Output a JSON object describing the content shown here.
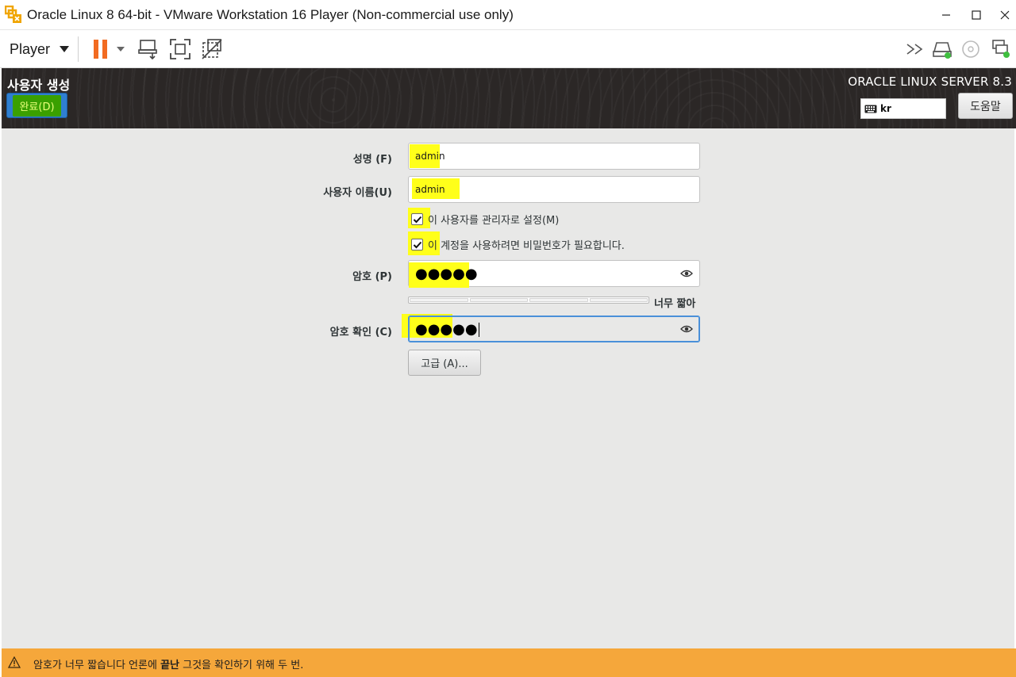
{
  "window": {
    "title": "Oracle Linux 8 64-bit - VMware Workstation 16 Player (Non-commercial use only)",
    "minimize": "—",
    "maximize": "☐",
    "close": "✕"
  },
  "toolbar": {
    "player_label": "Player",
    "icons": [
      "pause-icon",
      "dropdown-caret-icon",
      "send-ctrl-alt-del-icon",
      "full-screen-icon",
      "unity-icon",
      "forward-arrows-icon",
      "hard-disk-icon",
      "cd-rom-icon",
      "network-adapter-icon"
    ],
    "accent_color": "#f26b21",
    "device_active_color": "#3fbf3f"
  },
  "header": {
    "spoke_title": "사용자 생성",
    "done_label": "완료(D)",
    "product_title": "ORACLE LINUX SERVER 8.3",
    "keyboard_layout": "kr",
    "help_label": "도움말"
  },
  "form": {
    "fullname_label": "성명 (F)",
    "fullname_value": "admin",
    "username_label": "사용자 이름(U)",
    "username_value": "admin",
    "admin_checkbox_label": "이 사용자를 관리자로 설정(M)",
    "admin_checked": true,
    "require_password_label": "이 계정을 사용하려면 비밀번호가 필요합니다.",
    "require_password_checked": true,
    "password_label": "암호 (P)",
    "password_value": "●●●●●",
    "strength_label": "너무 짧아",
    "strength_level": 0,
    "confirm_label": "암호 확인 (C)",
    "confirm_value": "●●●●●",
    "advanced_label": "고급 (A)..."
  },
  "warning": {
    "text_before": "암호가 너무 짧습니다 언론에 ",
    "text_bold": "끝난",
    "text_after": " 그것을 확인하기 위해 두 번.",
    "color": "#f5a73b"
  },
  "highlight_color": "#ffff1a"
}
